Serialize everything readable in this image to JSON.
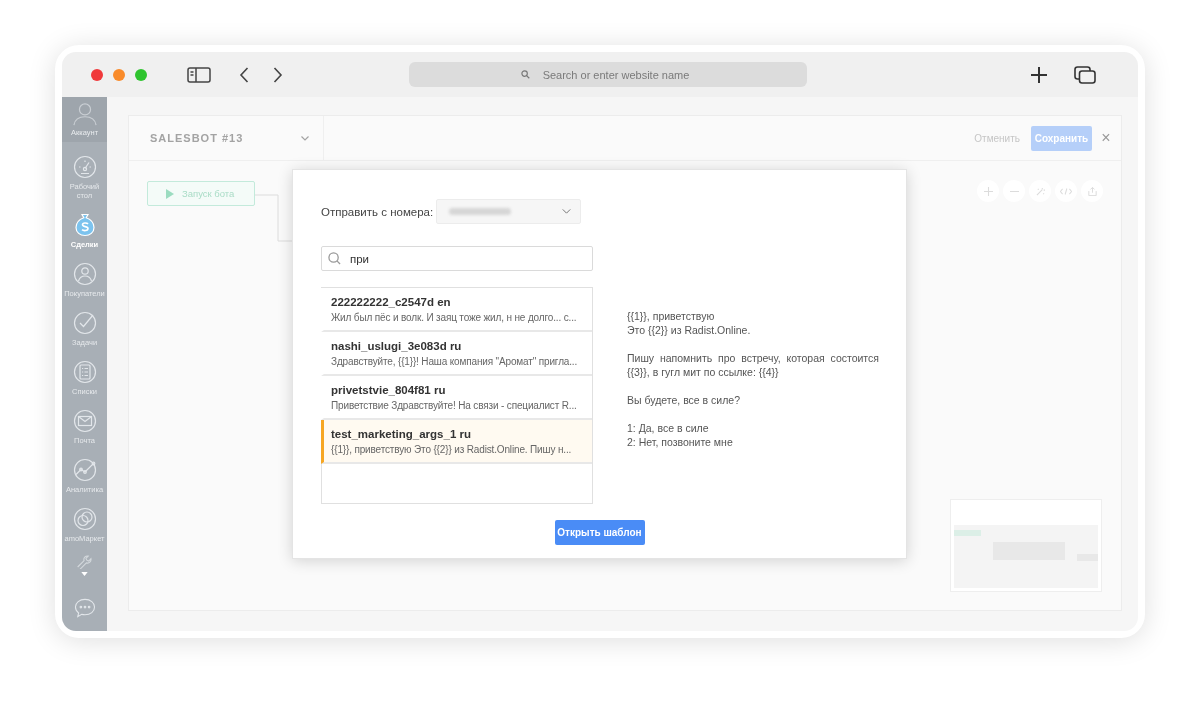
{
  "browser": {
    "address_bar": {
      "placeholder": "Search or enter website name"
    }
  },
  "sidebar": {
    "account": {
      "label": "Аккаунт"
    },
    "items": [
      {
        "label": "Рабочий стол",
        "selected": false
      },
      {
        "label": "Сделки",
        "selected": true
      },
      {
        "label": "Покупатели",
        "selected": false
      },
      {
        "label": "Задачи",
        "selected": false
      },
      {
        "label": "Списки",
        "selected": false
      },
      {
        "label": "Почта",
        "selected": false
      },
      {
        "label": "Аналитика",
        "selected": false
      },
      {
        "label": "amoМаркет",
        "selected": false
      }
    ]
  },
  "salesbot": {
    "title": "SALESBOT #13",
    "cancel": "Отменить",
    "save": "Сохранить",
    "close": "×",
    "start_node": {
      "label": "Запуск бота"
    }
  },
  "modal": {
    "sender_label": "Отправить с номера:",
    "search": {
      "value": "при"
    },
    "templates": [
      {
        "name": "222222222_c2547d en",
        "preview": "Жил был пёс и волк. И заяц тоже жил, н не долго... с...",
        "selected": false
      },
      {
        "name": "nashi_uslugi_3e083d ru",
        "preview": "Здравствуйте, {{1}}! Наша компания \"Аромат\" пригла...",
        "selected": false
      },
      {
        "name": "privetstvie_804f81 ru",
        "preview": "Приветствие Здравствуйте! На связи - специалист R...",
        "selected": false
      },
      {
        "name": "test_marketing_args_1 ru",
        "preview": "{{1}}, приветствую Это {{2}} из Radist.Online. Пишу н...",
        "selected": true
      }
    ],
    "message": [
      "{{1}}, приветствую\nЭто {{2}} из Radist.Online.",
      "Пишу напомнить про встречу, которая состоится {{3}}, в гугл мит по ссылке: {{4}}",
      "Вы будете, все в силе?",
      "1: Да, все в силе\n2: Нет, позвоните мне"
    ],
    "open_button": "Открыть шаблон"
  }
}
